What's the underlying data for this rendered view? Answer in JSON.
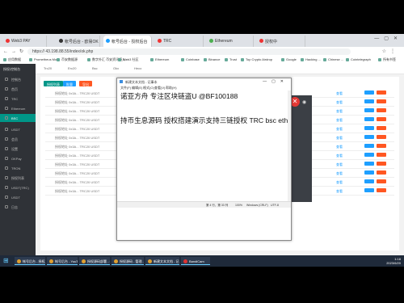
{
  "browser": {
    "tabs": [
      {
        "label": "Web3 PAY",
        "color": "#e33"
      },
      {
        "label": "帐号后台 - 欧易OK",
        "color": "#333"
      },
      {
        "label": "帐号后台 - 授权后台",
        "color": "#1e9fff"
      },
      {
        "label": "TRC",
        "color": "#e33"
      },
      {
        "label": "Ethereum",
        "color": "#4caf50"
      },
      {
        "label": "授权中",
        "color": "#e33"
      }
    ],
    "url": "https://  43.198.88.55/index/ok.php",
    "bookmarks": [
      "应用数据",
      "Prometheus Mo...",
      "币安数据源",
      "数字外汇 币安资讯接入...",
      "Web3 社区",
      "Ethereum",
      "Coinbase",
      "Binance",
      "Trust",
      "Top Crypto Airdrop",
      "Google",
      "Hacking ...",
      "Chinese ...",
      "Cointelegraph",
      "所有书签"
    ]
  },
  "admin": {
    "logo": "授权/控制台",
    "sidebar": [
      "控制台",
      "首页",
      "TRC",
      "Ethereum",
      "BSC",
      "USDT",
      "会员",
      "设置",
      "OKPay",
      "TRON",
      "授权列表",
      "USDT(TRC)",
      "USDT",
      "日志"
    ],
    "topbar": [
      "Trc20",
      "Erc20",
      "Bsc",
      "Okx",
      "Heco"
    ],
    "buttons": [
      "授权列表",
      "批量",
      "导出"
    ],
    "row_text": "授权地址 0x3A... TRC20 USDT",
    "row_status": "查看",
    "leftlist": [
      "授权地址",
      "授权时间",
      "转账记录",
      "授权状态",
      "操作日志"
    ]
  },
  "notepad": {
    "title": "新建文本文档 - 记事本",
    "menu": [
      "文件(F)",
      "编辑(E)",
      "格式(O)",
      "查看(V)",
      "帮助(H)"
    ],
    "line1": "诺亚方舟 专注区块链盗U   @BF100188",
    "line2": "持币生息源码 授权搭建演示支持三链授权 TRC bsc eth",
    "status": [
      "第 4 行，第 33 列",
      "100%",
      "Windows (CRLF)",
      "UTF-8"
    ]
  },
  "taskbar": {
    "items": [
      "帐号后台 - 授权后台...",
      "帐号后台 - YouTu...",
      "授权源码部署 - S...",
      "授权源码 - 管理...",
      "新建文本文档 - 记...",
      "BandiCam"
    ],
    "time": "1:18",
    "date": "2023/6/20"
  }
}
